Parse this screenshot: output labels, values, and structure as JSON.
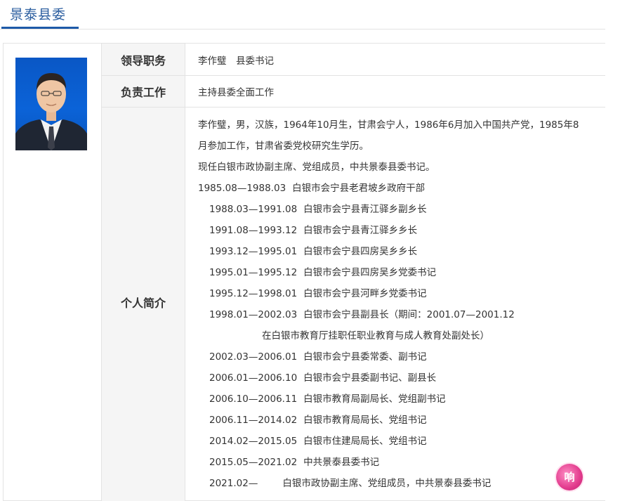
{
  "header": {
    "title": "景泰县委"
  },
  "leader": {
    "position_label": "领导职务",
    "position_value": "李作璧　县委书记",
    "duty_label": "负责工作",
    "duty_value": "主持县委全面工作",
    "bio_label": "个人简介",
    "bio_lines": [
      "李作璧，男，汉族，1964年10月生，甘肃会宁人，1986年6月加入中国共产党，1985年8",
      "月参加工作，甘肃省委党校研究生学历。",
      "现任白银市政协副主席、党组成员，中共景泰县委书记。"
    ],
    "career": [
      {
        "period": "1985.08—1988.03",
        "desc": "白银市会宁县老君坡乡政府干部"
      },
      {
        "period": "1988.03—1991.08",
        "desc": "白银市会宁县青江驿乡副乡长"
      },
      {
        "period": "1991.08—1993.12",
        "desc": "白银市会宁县青江驿乡乡长"
      },
      {
        "period": "1993.12—1995.01",
        "desc": "白银市会宁县四房吴乡乡长"
      },
      {
        "period": "1995.01—1995.12",
        "desc": "白银市会宁县四房吴乡党委书记"
      },
      {
        "period": "1995.12—1998.01",
        "desc": "白银市会宁县河畔乡党委书记"
      },
      {
        "period": "1998.01—2002.03",
        "desc": "白银市会宁县副县长（期间：2001.07—2001.12"
      },
      {
        "period": "",
        "desc": "在白银市教育厅挂职任职业教育与成人教育处副处长）"
      },
      {
        "period": "2002.03—2006.01",
        "desc": "白银市会宁县委常委、副书记"
      },
      {
        "period": "2006.01—2006.10",
        "desc": "白银市会宁县委副书记、副县长"
      },
      {
        "period": "2006.10—2006.11",
        "desc": "白银市教育局副局长、党组副书记"
      },
      {
        "period": "2006.11—2014.02",
        "desc": "白银市教育局局长、党组书记"
      },
      {
        "period": "2014.02—2015.05",
        "desc": "白银市住建局局长、党组书记"
      },
      {
        "period": "2015.05—2021.02",
        "desc": "中共景泰县委书记"
      },
      {
        "period": "2021.02—",
        "desc": "白银市政协副主席、党组成员，中共景泰县委书记"
      }
    ]
  },
  "watermark": {
    "text": "响"
  },
  "colors": {
    "title": "#2a5d9f",
    "accent_bar": "#1e5aa8",
    "label_bg": "#f5f5f5",
    "border": "#e3e3e3"
  }
}
